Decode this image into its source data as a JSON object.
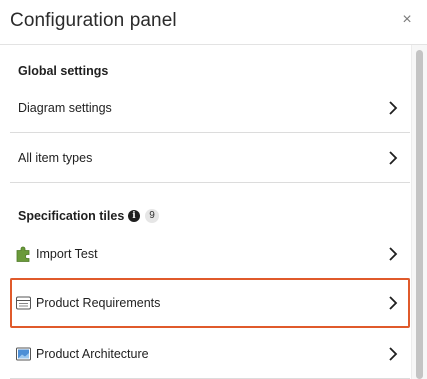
{
  "panel": {
    "title": "Configuration panel",
    "close_icon": "close-icon",
    "close_glyph": "×"
  },
  "global_settings": {
    "heading": "Global settings",
    "items": [
      {
        "label": "Diagram settings",
        "icon": "chevron-right-icon"
      },
      {
        "label": "All item types",
        "icon": "chevron-right-icon"
      }
    ]
  },
  "specification_tiles": {
    "heading": "Specification tiles",
    "info_icon": "info-icon",
    "info_glyph": "i",
    "count": "9",
    "items": [
      {
        "label": "Import Test",
        "icon": "puzzle-piece-icon",
        "selected": false
      },
      {
        "label": "Product Requirements",
        "icon": "table-icon",
        "selected": true
      },
      {
        "label": "Product Architecture",
        "icon": "image-icon",
        "selected": false
      }
    ]
  },
  "colors": {
    "highlight": "#e05a2b",
    "puzzle_green": "#6a9a3a",
    "image_blue": "#4d8fd6"
  }
}
